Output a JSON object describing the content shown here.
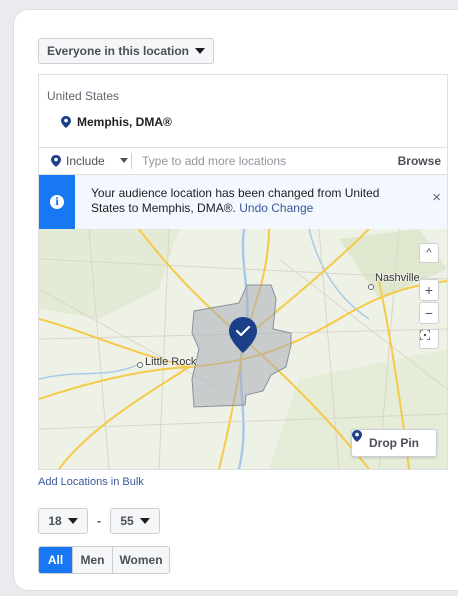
{
  "audience_scope": {
    "label": "Everyone in this location"
  },
  "locations": {
    "country": "United States",
    "selected_place": "Memphis, DMA®",
    "include_label": "Include",
    "input_placeholder": "Type to add more locations",
    "browse_label": "Browse"
  },
  "notice": {
    "message": "Your audience location has been changed from United States to Memphis, DMA®.",
    "undo_label": "Undo Change",
    "close_glyph": "×"
  },
  "map": {
    "labels": {
      "nashville": "Nashville",
      "little_rock": "Little Rock"
    },
    "zoom_in": "+",
    "zoom_out": "−",
    "collapse": "^",
    "drop_pin_label": "Drop Pin",
    "colors": {
      "region_fill": "#a9adb8",
      "pin": "#1d3f8a",
      "roads": "#f6c947"
    }
  },
  "bulk_link": "Add Locations in Bulk",
  "age": {
    "min": "18",
    "max": "55",
    "separator": "-"
  },
  "gender": {
    "all": "All",
    "men": "Men",
    "women": "Women",
    "selected": "All"
  },
  "colors": {
    "accent": "#1877f2",
    "link": "#385898"
  }
}
